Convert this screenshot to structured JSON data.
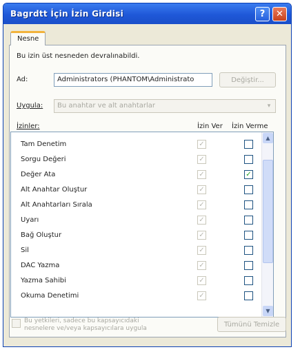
{
  "window": {
    "title": "Bagrdtt İçin İzin Girdisi",
    "help_label": "?",
    "close_label": "✕"
  },
  "tabs": [
    {
      "label": "Nesne"
    }
  ],
  "info_text": "Bu izin üst nesneden devralınabildi.",
  "name_field": {
    "label": "Ad:",
    "value": "Administrators (PHANTOM\\Administrato",
    "change_button": "Değiştir..."
  },
  "apply_to": {
    "label": "Uygula:",
    "value": "Bu anahtar ve alt anahtarlar",
    "arrow": "▾"
  },
  "permissions": {
    "header_label": "İzinler:",
    "col_allow": "İzin Ver",
    "col_deny": "İzin Verme",
    "rows": [
      {
        "name": "Tam Denetim",
        "allow": true,
        "deny": false
      },
      {
        "name": "Sorgu Değeri",
        "allow": true,
        "deny": false
      },
      {
        "name": "Değer Ata",
        "allow": true,
        "deny": true
      },
      {
        "name": "Alt Anahtar Oluştur",
        "allow": true,
        "deny": false
      },
      {
        "name": "Alt Anahtarları Sırala",
        "allow": true,
        "deny": false
      },
      {
        "name": "Uyarı",
        "allow": true,
        "deny": false
      },
      {
        "name": "Bağ Oluştur",
        "allow": true,
        "deny": false
      },
      {
        "name": "Sil",
        "allow": true,
        "deny": false
      },
      {
        "name": "DAC Yazma",
        "allow": true,
        "deny": false
      },
      {
        "name": "Yazma Sahibi",
        "allow": true,
        "deny": false
      },
      {
        "name": "Okuma Denetimi",
        "allow": true,
        "deny": false
      }
    ],
    "scroll_up": "▲",
    "scroll_down": "▼"
  },
  "apply_inherit": {
    "label": "Bu yetkileri, sadece bu kapsayıcıdaki nesnelere ve/veya kapsayıcılara uygula"
  },
  "clear_all_button": "Tümünü Temizle",
  "check_glyph": "✓",
  "colors": {
    "title_bar": "#1f58d8",
    "dialog_bg": "#ece9d8",
    "tab_accent": "#f2b33c",
    "checked_mark": "#21a121"
  }
}
